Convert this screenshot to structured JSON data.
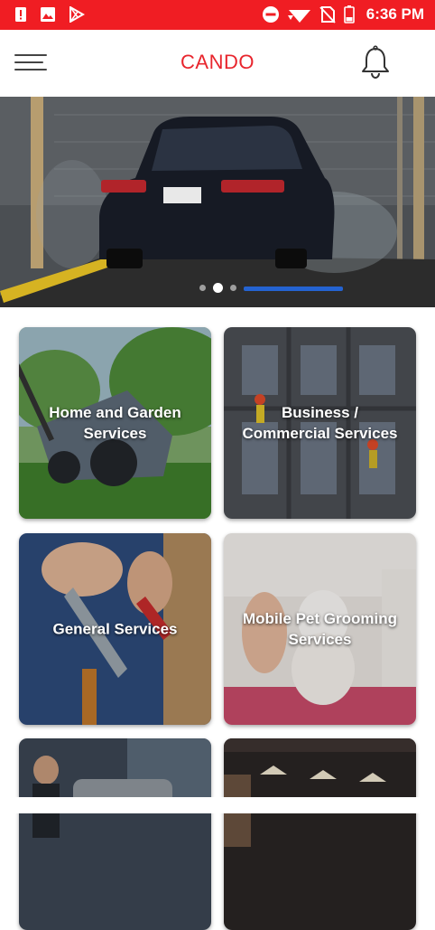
{
  "status_bar": {
    "time": "6:36 PM",
    "left_icons": [
      "alert-notification-icon",
      "image-notification-icon",
      "play-store-icon"
    ],
    "right_icons": [
      "do-not-disturb-icon",
      "wifi-icon",
      "no-sim-icon",
      "battery-icon"
    ],
    "color": "#f01d23"
  },
  "app_bar": {
    "title": "CANDO",
    "title_color": "#e8252d",
    "menu_icon": "hamburger-menu-icon",
    "notification_icon": "bell-icon"
  },
  "banner": {
    "image": "car-wash-photo",
    "slide_count": 3,
    "active_slide": 2
  },
  "services": [
    {
      "label": "Home and Garden Services",
      "image": "lawn-mower-photo"
    },
    {
      "label": "Business / Commercial Services",
      "image": "window-cleaners-building-photo"
    },
    {
      "label": "General Services",
      "image": "electrician-tools-photo"
    },
    {
      "label": "Mobile Pet Grooming Services",
      "image": "puppy-grooming-photo"
    },
    {
      "label": "",
      "image": "mechanic-garage-photo"
    },
    {
      "label": "",
      "image": "interior-lights-photo"
    }
  ]
}
